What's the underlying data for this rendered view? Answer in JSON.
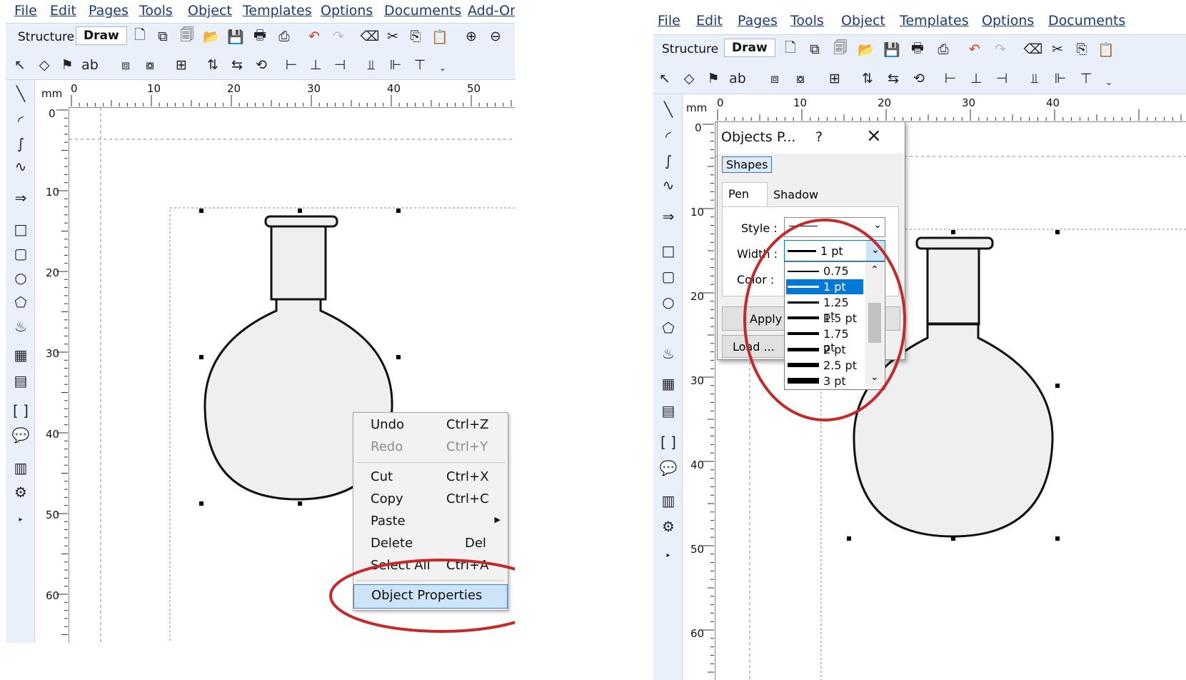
{
  "menu": [
    "File",
    "Edit",
    "Pages",
    "Tools",
    "Object",
    "Templates",
    "Options",
    "Documents",
    "Add-On"
  ],
  "tabs": {
    "structure": "Structure",
    "draw": "Draw"
  },
  "ruler": {
    "unit": "mm",
    "h_labels_left": [
      "0",
      "10",
      "20",
      "30",
      "40",
      "50"
    ],
    "v_labels_left": [
      "0",
      "10",
      "20",
      "30",
      "40",
      "50",
      "60"
    ],
    "h_labels_right": [
      "0",
      "10",
      "20",
      "30",
      "40"
    ],
    "v_labels_right": [
      "0",
      "10",
      "20",
      "30",
      "40",
      "50",
      "60"
    ]
  },
  "context_menu": {
    "items": [
      {
        "label": "Undo",
        "shortcut": "Ctrl+Z",
        "enabled": true
      },
      {
        "label": "Redo",
        "shortcut": "Ctrl+Y",
        "enabled": false
      },
      {
        "label": "Cut",
        "shortcut": "Ctrl+X",
        "enabled": true
      },
      {
        "label": "Copy",
        "shortcut": "Ctrl+C",
        "enabled": true
      },
      {
        "label": "Paste",
        "shortcut": "",
        "enabled": true
      },
      {
        "label": "Delete",
        "shortcut": "Del",
        "enabled": true
      },
      {
        "label": "Select All",
        "shortcut": "Ctrl+A",
        "enabled": true
      },
      {
        "label": "Object Properties",
        "shortcut": "",
        "enabled": true
      }
    ]
  },
  "dialog": {
    "title": "Objects P...",
    "help": "?",
    "close": "×",
    "shapes_tab": "Shapes",
    "pen_tab": "Pen",
    "shadow_tab": "Shadow",
    "style_label": "Style :",
    "width_label": "Width :",
    "color_label": "Color :",
    "width_value": "1 pt",
    "apply_button": "Apply",
    "load_button": "Load ...",
    "width_options": [
      "0.75 pt",
      "1 pt",
      "1.25 pt",
      "1.5 pt",
      "1.75 pt",
      "2 pt",
      "2.5 pt",
      "3 pt"
    ],
    "selected_width": "1 pt"
  },
  "colors": {
    "accent": "#0078d7",
    "annotation": "#c42a2a",
    "toolbar_bg": "#e9f0fa",
    "menu_text": "#1a3a7a",
    "flask_fill": "#efefef"
  }
}
